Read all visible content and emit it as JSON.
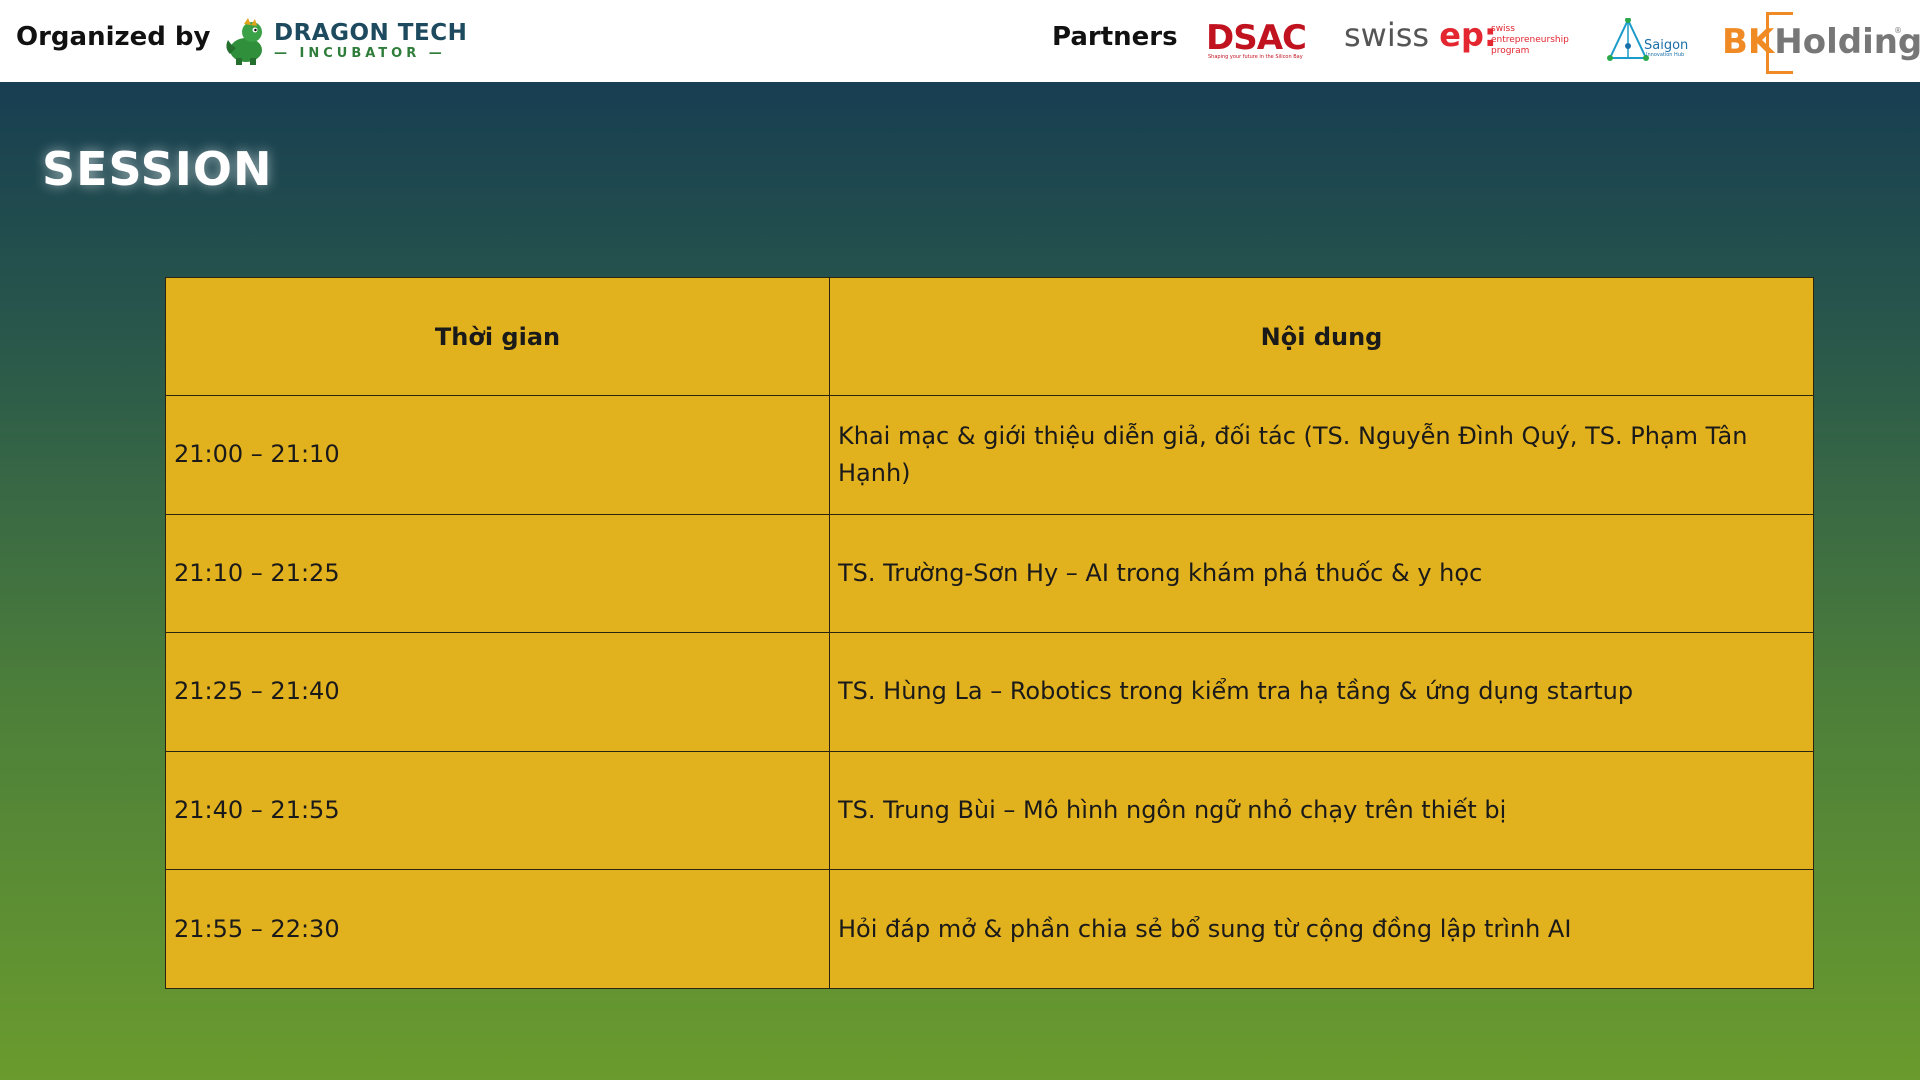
{
  "header": {
    "organized_by_label": "Organized by",
    "organizer": {
      "name_line1": "DRAGON TECH",
      "name_line2": "INCUBATOR",
      "icon": "dragon-mascot-icon"
    },
    "partners_label": "Partners",
    "partners": [
      {
        "name": "DSAC",
        "tagline": "Shaping your future in the Silicon Bay"
      },
      {
        "name": "swiss",
        "name_accent": "ep:",
        "tagline": "swiss entrepreneurship program"
      },
      {
        "name": "Saigon",
        "tagline": "Innovation Hub"
      },
      {
        "name_accent": "BK",
        "name": "Holdings",
        "mark": "®"
      }
    ]
  },
  "slide": {
    "title": "SESSION",
    "table": {
      "headers": [
        "Thời gian",
        "Nội dung"
      ],
      "rows": [
        {
          "time": "21:00 – 21:10",
          "content": "Khai mạc & giới thiệu diễn giả, đối tác (TS. Nguyễn Đình Quý, TS. Phạm Tân Hạnh)"
        },
        {
          "time": "21:10 – 21:25",
          "content": "TS. Trường-Sơn Hy – AI trong khám phá thuốc & y học"
        },
        {
          "time": "21:25 – 21:40",
          "content": "TS. Hùng La – Robotics trong kiểm tra hạ tầng & ứng dụng startup"
        },
        {
          "time": "21:40 – 21:55",
          "content": "TS. Trung Bùi – Mô hình ngôn ngữ nhỏ chạy trên thiết bị"
        },
        {
          "time": "21:55 – 22:30",
          "content": "Hỏi đáp mở & phần chia sẻ bổ sung từ cộng đồng lập trình AI"
        }
      ]
    }
  },
  "colors": {
    "table_fill": "#e2b11e",
    "background_top": "#173e52",
    "background_bottom": "#6a9b2e",
    "dsac_red": "#c1121f",
    "bk_orange": "#f08a24"
  }
}
